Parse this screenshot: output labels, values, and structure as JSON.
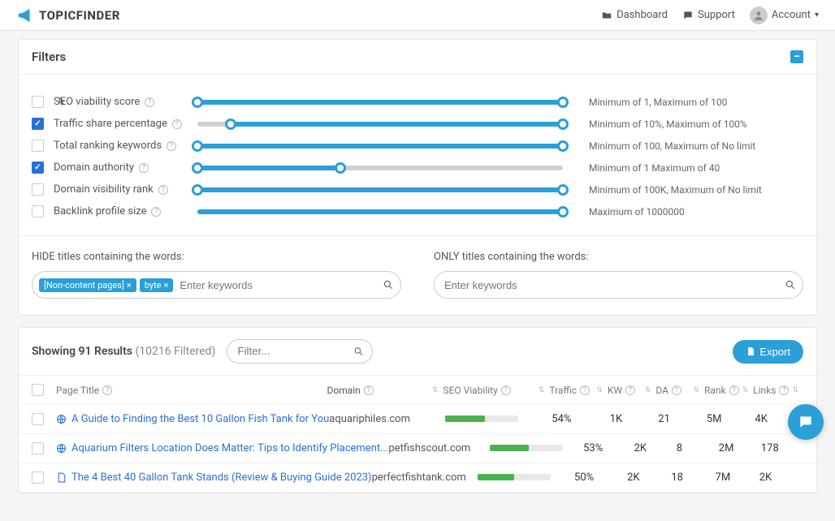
{
  "brand": "TOPICFINDER",
  "nav": {
    "dashboard": "Dashboard",
    "support": "Support",
    "account": "Account"
  },
  "filters_panel": {
    "title": "Filters",
    "rows": [
      {
        "checked": false,
        "label": "SEO viability score",
        "lo": 0,
        "hi": 100,
        "summary": "Minimum of 1, Maximum of 100",
        "cursor": true
      },
      {
        "checked": true,
        "label": "Traffic share percentage",
        "lo": 9,
        "hi": 100,
        "summary": "Minimum of 10%, Maximum of 100%"
      },
      {
        "checked": false,
        "label": "Total ranking keywords",
        "lo": 0,
        "hi": 100,
        "summary": "Minimum of 100, Maximum of No limit"
      },
      {
        "checked": true,
        "label": "Domain authority",
        "lo": 0,
        "hi": 39,
        "summary": "Minimum of 1 Maximum of 40"
      },
      {
        "checked": false,
        "label": "Domain visibility rank",
        "lo": 0,
        "hi": 100,
        "summary": "Minimum of 100K, Maximum of No limit"
      },
      {
        "checked": false,
        "label": "Backlink profile size",
        "lo": 0,
        "hi": 100,
        "summary": "Maximum of 1000000",
        "single": true
      }
    ],
    "hide_label": "HIDE titles containing the words:",
    "only_label": "ONLY titles containing the words:",
    "hide_tags": [
      "[Non-content pages]",
      "byte"
    ],
    "hide_placeholder": "Enter keywords",
    "only_placeholder": "Enter keywords"
  },
  "results": {
    "showing": "Showing 91 Results",
    "filtered": "(10216 Filtered)",
    "filter_placeholder": "Filter...",
    "export": "Export",
    "columns": {
      "page_title": "Page Title",
      "domain": "Domain",
      "seo": "SEO Viability",
      "traffic": "Traffic",
      "kw": "KW",
      "da": "DA",
      "rank": "Rank",
      "links": "Links"
    },
    "rows": [
      {
        "icon": "globe",
        "title": "A Guide to Finding the Best 10 Gallon Fish Tank for You",
        "domain": "aquariphiles.com",
        "seo_pct": 54,
        "traffic": "54%",
        "kw": "1K",
        "da": "21",
        "rank": "5M",
        "links": "4K"
      },
      {
        "icon": "globe",
        "title": "Aquarium Filters Location Does Matter: Tips to Identify Placement...",
        "domain": "petfishscout.com",
        "seo_pct": 53,
        "traffic": "53%",
        "kw": "2K",
        "da": "8",
        "rank": "2M",
        "links": "178"
      },
      {
        "icon": "doc",
        "title": "The 4 Best 40 Gallon Tank Stands (Review & Buying Guide 2023)",
        "domain": "perfectfishtank.com",
        "seo_pct": 50,
        "traffic": "50%",
        "kw": "2K",
        "da": "18",
        "rank": "7M",
        "links": "2K"
      }
    ]
  }
}
